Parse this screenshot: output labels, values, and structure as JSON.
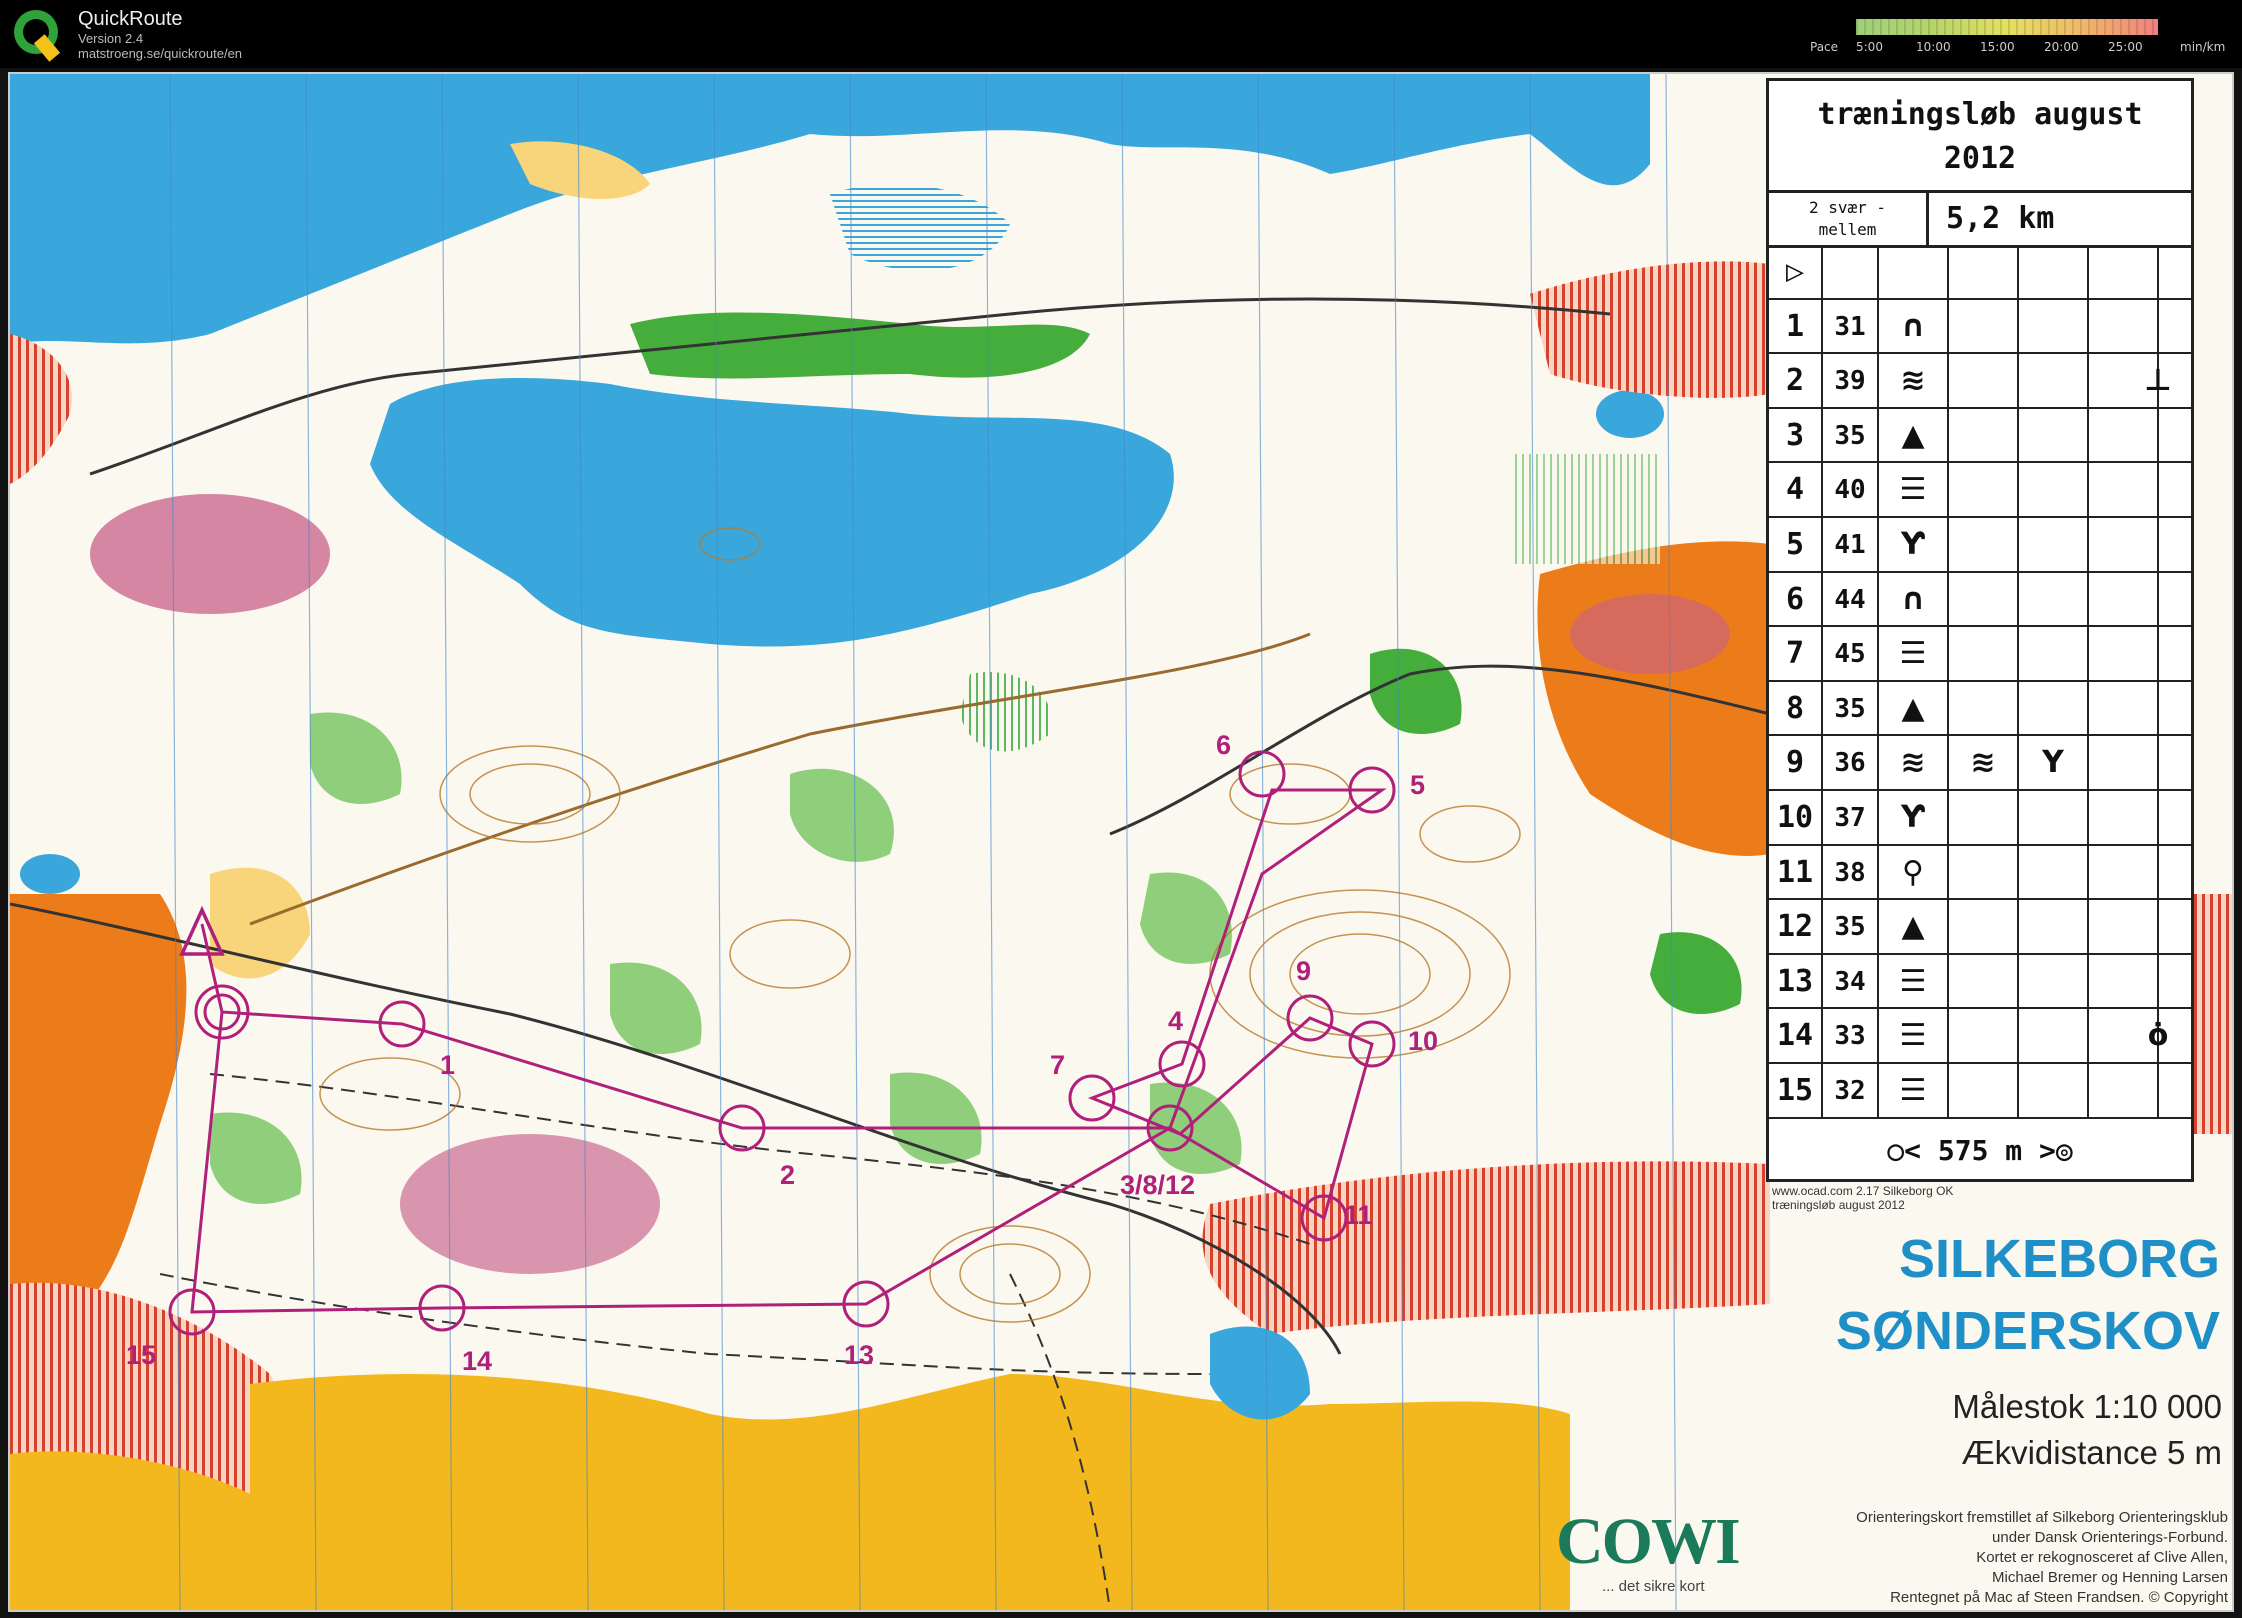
{
  "app": {
    "title": "QuickRoute",
    "version": "Version 2.4",
    "url": "matstroeng.se/quickroute/en",
    "logo_letter": "Q"
  },
  "pace_legend": {
    "label": "Pace",
    "ticks": [
      "5:00",
      "10:00",
      "15:00",
      "20:00",
      "25:00"
    ],
    "unit": "min/km"
  },
  "description_sheet": {
    "title_line1": "træningsløb august",
    "title_line2": "2012",
    "class_line1": "2 svær -",
    "class_line2": "mellem",
    "length": "5,2 km",
    "start_symbol": "▷",
    "rows": [
      {
        "num": "1",
        "code": "31",
        "symbol": "∩",
        "extra": ""
      },
      {
        "num": "2",
        "code": "39",
        "symbol": "≋",
        "extra": "⊥"
      },
      {
        "num": "3",
        "code": "35",
        "symbol": "▲",
        "extra": ""
      },
      {
        "num": "4",
        "code": "40",
        "symbol": "☰",
        "extra": ""
      },
      {
        "num": "5",
        "code": "41",
        "symbol": "Ƴ",
        "extra": ""
      },
      {
        "num": "6",
        "code": "44",
        "symbol": "∩",
        "extra": ""
      },
      {
        "num": "7",
        "code": "45",
        "symbol": "☰",
        "extra": ""
      },
      {
        "num": "8",
        "code": "35",
        "symbol": "▲",
        "extra": ""
      },
      {
        "num": "9",
        "code": "36",
        "symbol": "≋",
        "symbol2": "≋",
        "symbol3": "Y",
        "extra": ""
      },
      {
        "num": "10",
        "code": "37",
        "symbol": "Ƴ",
        "extra": ""
      },
      {
        "num": "11",
        "code": "38",
        "symbol": "⚲",
        "extra": ""
      },
      {
        "num": "12",
        "code": "35",
        "symbol": "▲",
        "extra": ""
      },
      {
        "num": "13",
        "code": "34",
        "symbol": "☰",
        "extra": ""
      },
      {
        "num": "14",
        "code": "33",
        "symbol": "☰",
        "extra": "ȯ"
      },
      {
        "num": "15",
        "code": "32",
        "symbol": "☰",
        "extra": ""
      }
    ],
    "finish": "○<  575 m  >◎"
  },
  "imprint": {
    "line1": "www.ocad.com 2.17 Silkeborg OK",
    "line2": "træningsløb august 2012"
  },
  "map_title": {
    "line1": "SILKEBORG",
    "line2": "SØNDERSKOV",
    "scale": "Målestok 1:10 000",
    "contour": "Ækvidistance 5 m"
  },
  "cowi": {
    "logo": "COWI",
    "tagline": "... det sikre kort"
  },
  "credits": [
    "Orienteringskort fremstillet af Silkeborg Orienteringsklub",
    "under Dansk Orienterings-Forbund.",
    "Kortet er rekognosceret af Clive Allen,",
    "Michael Bremer og Henning Larsen",
    "Rentegnet på Mac af Steen Frandsen. © Copyright"
  ],
  "controls": [
    {
      "label": "1"
    },
    {
      "label": "2"
    },
    {
      "label": "3/8/12"
    },
    {
      "label": "4"
    },
    {
      "label": "5"
    },
    {
      "label": "6"
    },
    {
      "label": "7"
    },
    {
      "label": "9"
    },
    {
      "label": "10"
    },
    {
      "label": "11"
    },
    {
      "label": "13"
    },
    {
      "label": "14"
    },
    {
      "label": "15"
    }
  ],
  "colors": {
    "water": "#3aa7dc",
    "forest_green": "#45ad3c",
    "open_yellow": "#f2b81d",
    "rough_orange": "#ec7b1a",
    "course_purple": "#b0207a",
    "title_blue": "#1f8fc8",
    "cowi_green": "#1a7a5a"
  }
}
